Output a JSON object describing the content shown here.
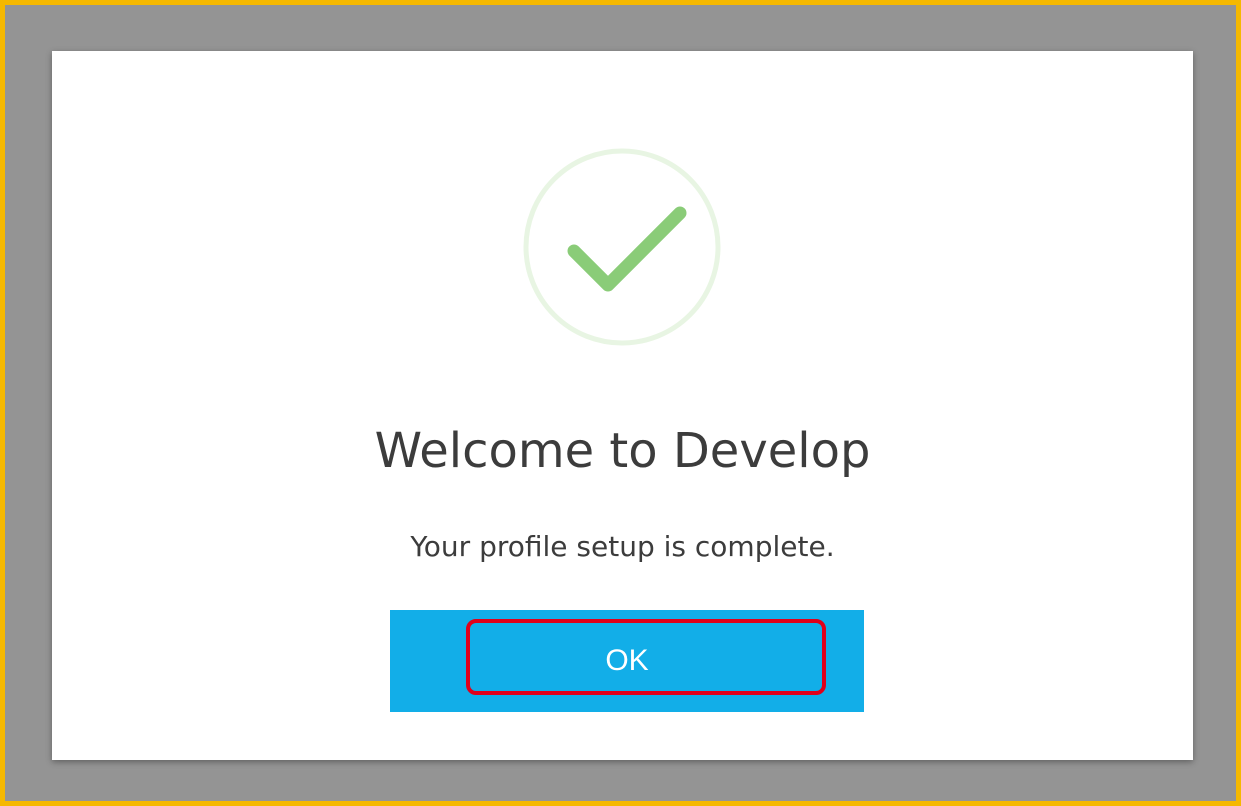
{
  "dialog": {
    "title": "Welcome to Develop",
    "message": "Your profile setup is complete.",
    "ok_label": "OK",
    "icon": "check-circle-icon"
  },
  "colors": {
    "frame_border": "#F5B800",
    "backdrop": "#949494",
    "dialog_bg": "#FFFFFF",
    "check_green": "#8ACC78",
    "ring_green": "#E8F5E3",
    "button_bg": "#12AEE8",
    "button_text": "#FFFFFF",
    "highlight": "#E0001A",
    "text": "#3C3C3C"
  }
}
